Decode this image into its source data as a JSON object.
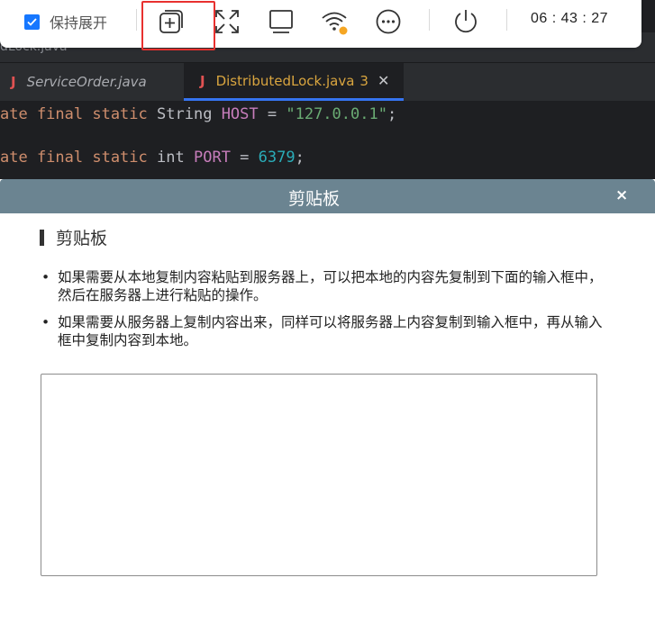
{
  "toolbar": {
    "keep_open_label": "保持展开",
    "keep_open_checked": true,
    "icons": [
      "add-window-icon",
      "fullscreen-icon",
      "monitor-icon",
      "wifi-icon",
      "more-icon",
      "power-icon"
    ],
    "wifi_status_color": "#f5a623",
    "clock": "06 : 43 : 27",
    "checkbox_color": "#1677ff",
    "highlight_color": "#e8312f"
  },
  "ide": {
    "file_label": "dLock.java",
    "tabs": [
      {
        "icon": "J",
        "label": "ServiceOrder.java",
        "active": false
      },
      {
        "icon": "J",
        "label": "DistributedLock.java",
        "badge": "3",
        "active": true
      }
    ],
    "code": {
      "line1": {
        "kw": "ate final static",
        "type": "String",
        "field": "HOST",
        "op": " = ",
        "value": "\"127.0.0.1\"",
        "end": ";"
      },
      "line2": {
        "kw": "ate final static",
        "type": "int",
        "field": "PORT",
        "op": " = ",
        "value": "6379",
        "end": ";"
      }
    }
  },
  "panel": {
    "title": "剪贴板",
    "close": "×",
    "header_color": "#6b8491",
    "section_title": "剪贴板",
    "tips": [
      "如果需要从本地复制内容粘贴到服务器上，可以把本地的内容先复制到下面的输入框中，然后在服务器上进行粘贴的操作。",
      "如果需要从服务器上复制内容出来，同样可以将服务器上内容复制到输入框中，再从输入框中复制内容到本地。"
    ],
    "textarea_value": ""
  }
}
